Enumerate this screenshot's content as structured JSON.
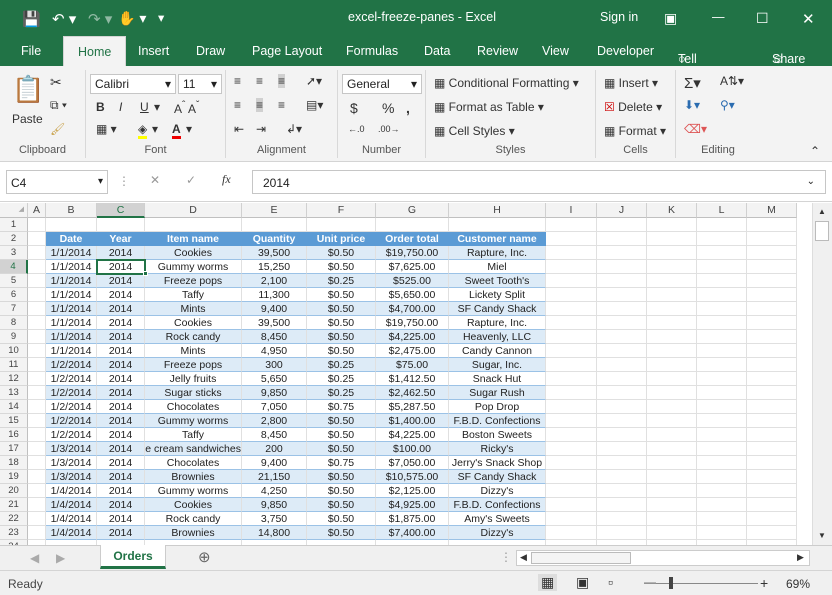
{
  "window": {
    "title": "excel-freeze-panes - Excel",
    "sign_in": "Sign in",
    "accent": "#217346"
  },
  "qat": {
    "save_icon": "save-icon",
    "undo_icon": "undo-icon",
    "redo_icon": "redo-icon",
    "touch_icon": "touch-mode-icon",
    "customize_icon": "customize-qat-icon"
  },
  "menu_tabs": [
    "File",
    "Home",
    "Insert",
    "Draw",
    "Page Layout",
    "Formulas",
    "Data",
    "Review",
    "View",
    "Developer"
  ],
  "tell_me": "Tell me",
  "share": "Share",
  "ribbon": {
    "clipboard": {
      "label": "Clipboard",
      "paste": "Paste"
    },
    "font": {
      "label": "Font",
      "name": "Calibri",
      "size": "11",
      "bold": "B",
      "italic": "I",
      "underline": "U"
    },
    "alignment": {
      "label": "Alignment"
    },
    "number": {
      "label": "Number",
      "format": "General",
      "currency": "$",
      "percent": "%",
      "comma": ","
    },
    "styles": {
      "label": "Styles",
      "conditional": "Conditional Formatting",
      "table": "Format as Table",
      "cell": "Cell Styles"
    },
    "cells": {
      "label": "Cells",
      "insert": "Insert",
      "delete": "Delete",
      "format": "Format"
    },
    "editing": {
      "label": "Editing"
    }
  },
  "formula_bar": {
    "name_box": "C4",
    "fx": "fx",
    "value": "2014"
  },
  "columns": [
    "A",
    "B",
    "C",
    "D",
    "E",
    "F",
    "G",
    "H",
    "I",
    "J",
    "K",
    "L",
    "M"
  ],
  "selected_column": "C",
  "selected_row": 4,
  "table": {
    "headers": [
      "Date",
      "Year",
      "Item name",
      "Quantity",
      "Unit price",
      "Order total",
      "Customer name"
    ],
    "rows": [
      [
        "1/1/2014",
        "2014",
        "Cookies",
        "39,500",
        "$0.50",
        "$19,750.00",
        "Rapture, Inc."
      ],
      [
        "1/1/2014",
        "2014",
        "Gummy worms",
        "15,250",
        "$0.50",
        "$7,625.00",
        "Miel"
      ],
      [
        "1/1/2014",
        "2014",
        "Freeze pops",
        "2,100",
        "$0.25",
        "$525.00",
        "Sweet Tooth's"
      ],
      [
        "1/1/2014",
        "2014",
        "Taffy",
        "11,300",
        "$0.50",
        "$5,650.00",
        "Lickety Split"
      ],
      [
        "1/1/2014",
        "2014",
        "Mints",
        "9,400",
        "$0.50",
        "$4,700.00",
        "SF Candy Shack"
      ],
      [
        "1/1/2014",
        "2014",
        "Cookies",
        "39,500",
        "$0.50",
        "$19,750.00",
        "Rapture, Inc."
      ],
      [
        "1/1/2014",
        "2014",
        "Rock candy",
        "8,450",
        "$0.50",
        "$4,225.00",
        "Heavenly, LLC"
      ],
      [
        "1/1/2014",
        "2014",
        "Mints",
        "4,950",
        "$0.50",
        "$2,475.00",
        "Candy Cannon"
      ],
      [
        "1/2/2014",
        "2014",
        "Freeze pops",
        "300",
        "$0.25",
        "$75.00",
        "Sugar, Inc."
      ],
      [
        "1/2/2014",
        "2014",
        "Jelly fruits",
        "5,650",
        "$0.25",
        "$1,412.50",
        "Snack Hut"
      ],
      [
        "1/2/2014",
        "2014",
        "Sugar sticks",
        "9,850",
        "$0.25",
        "$2,462.50",
        "Sugar Rush"
      ],
      [
        "1/2/2014",
        "2014",
        "Chocolates",
        "7,050",
        "$0.75",
        "$5,287.50",
        "Pop Drop"
      ],
      [
        "1/2/2014",
        "2014",
        "Gummy worms",
        "2,800",
        "$0.50",
        "$1,400.00",
        "F.B.D. Confections"
      ],
      [
        "1/2/2014",
        "2014",
        "Taffy",
        "8,450",
        "$0.50",
        "$4,225.00",
        "Boston Sweets"
      ],
      [
        "1/3/2014",
        "2014",
        "Ice cream sandwiches",
        "200",
        "$0.50",
        "$100.00",
        "Ricky's"
      ],
      [
        "1/3/2014",
        "2014",
        "Chocolates",
        "9,400",
        "$0.75",
        "$7,050.00",
        "Jerry's Snack Shop"
      ],
      [
        "1/3/2014",
        "2014",
        "Brownies",
        "21,150",
        "$0.50",
        "$10,575.00",
        "SF Candy Shack"
      ],
      [
        "1/4/2014",
        "2014",
        "Gummy worms",
        "4,250",
        "$0.50",
        "$2,125.00",
        "Dizzy's"
      ],
      [
        "1/4/2014",
        "2014",
        "Cookies",
        "9,850",
        "$0.50",
        "$4,925.00",
        "F.B.D. Confections"
      ],
      [
        "1/4/2014",
        "2014",
        "Rock candy",
        "3,750",
        "$0.50",
        "$1,875.00",
        "Amy's Sweets"
      ],
      [
        "1/4/2014",
        "2014",
        "Brownies",
        "14,800",
        "$0.50",
        "$7,400.00",
        "Dizzy's"
      ]
    ],
    "header_color": "#5b9bd5",
    "band_color": "#ddebf7"
  },
  "sheet_tabs": [
    "Orders"
  ],
  "status": {
    "ready": "Ready",
    "zoom": "69%",
    "zoom_percent": 69
  }
}
